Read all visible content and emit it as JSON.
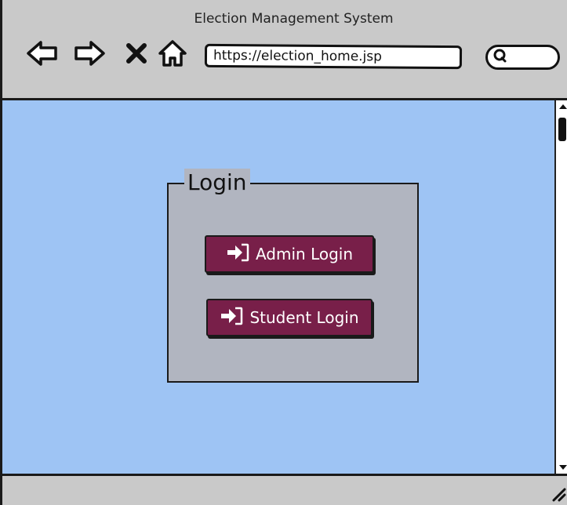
{
  "window": {
    "title": "Election Management System"
  },
  "toolbar": {
    "back_icon": "left-arrow-icon",
    "forward_icon": "right-arrow-icon",
    "stop_icon": "x-icon",
    "home_icon": "home-icon",
    "url": "https://election_home.jsp",
    "search_icon": "search-icon"
  },
  "login": {
    "legend": "Login",
    "admin_button": "Admin Login",
    "student_button": "Student Login",
    "button_icon": "sign-in-icon"
  },
  "colors": {
    "content_bg": "#9ec4f4",
    "panel_bg": "#b1b5c0",
    "button_bg": "#781f49"
  }
}
